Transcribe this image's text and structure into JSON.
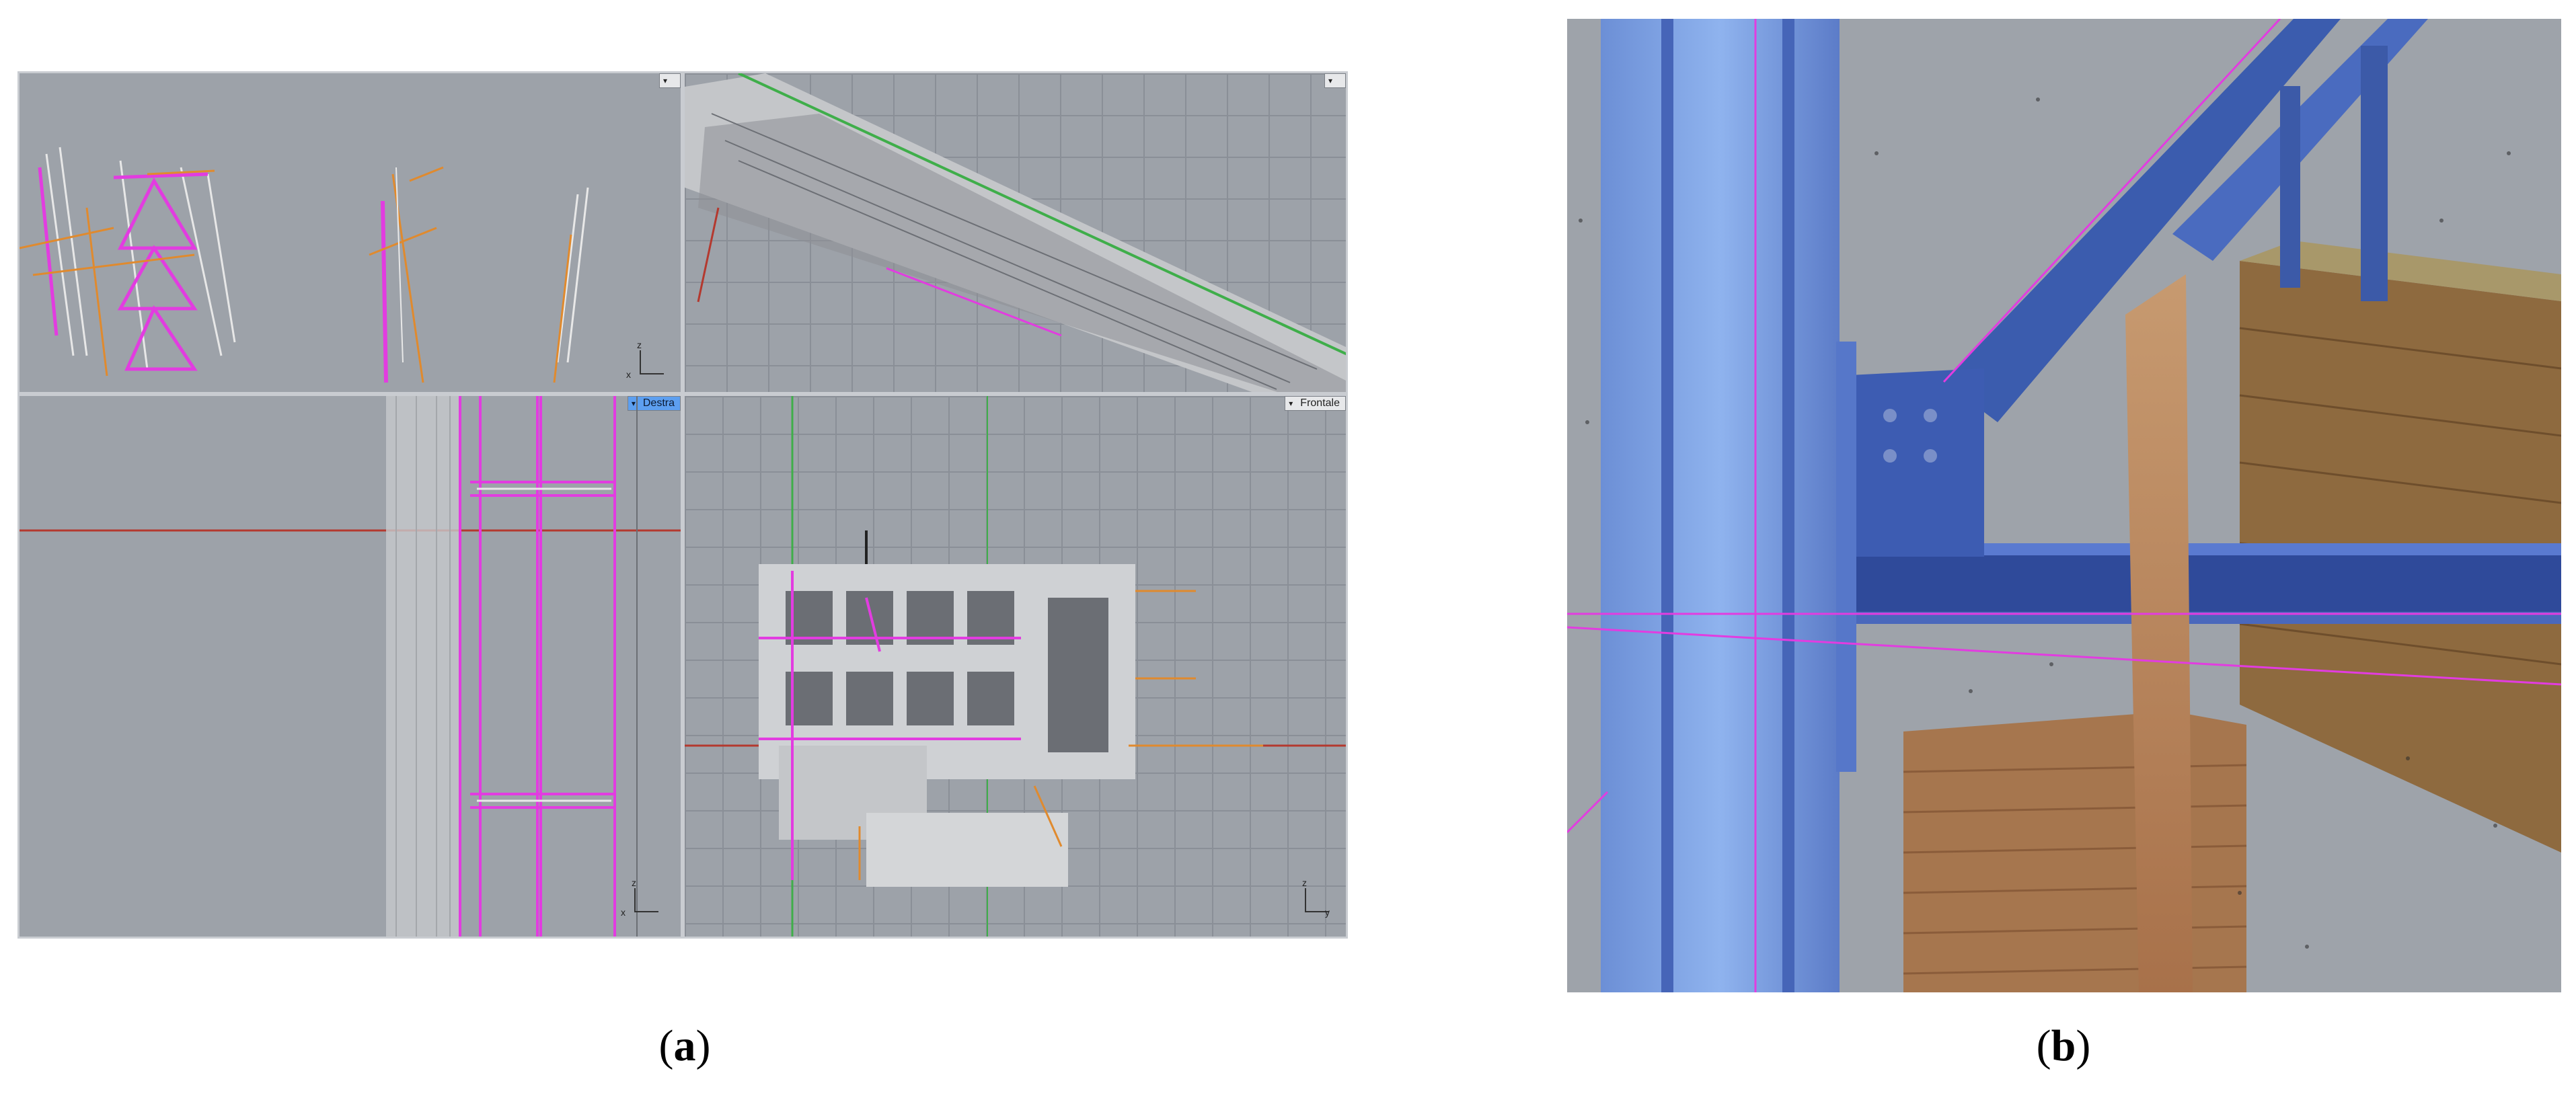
{
  "panel_a": {
    "viewports": {
      "top_left": {
        "tab_label": ""
      },
      "top_right": {
        "tab_label": ""
      },
      "bottom_left": {
        "tab_label": "Destra",
        "active": true
      },
      "bottom_right": {
        "tab_label": "Frontale"
      }
    },
    "axis_labels": {
      "x": "x",
      "y": "y",
      "z": "z"
    }
  },
  "captions": {
    "a": {
      "open": "(",
      "letter": "a",
      "close": ")"
    },
    "b": {
      "open": "(",
      "letter": "b",
      "close": ")"
    }
  },
  "colors": {
    "viewport_bg": "#9da2a9",
    "magenta_lines": "#e23ce0",
    "orange_lines": "#e08a2e",
    "red_axis": "#b4392f",
    "green_axis": "#3fae4a",
    "active_tab": "#5d9ff0",
    "steel_blue": "#3f5fb4",
    "brick": "#b9835a"
  }
}
